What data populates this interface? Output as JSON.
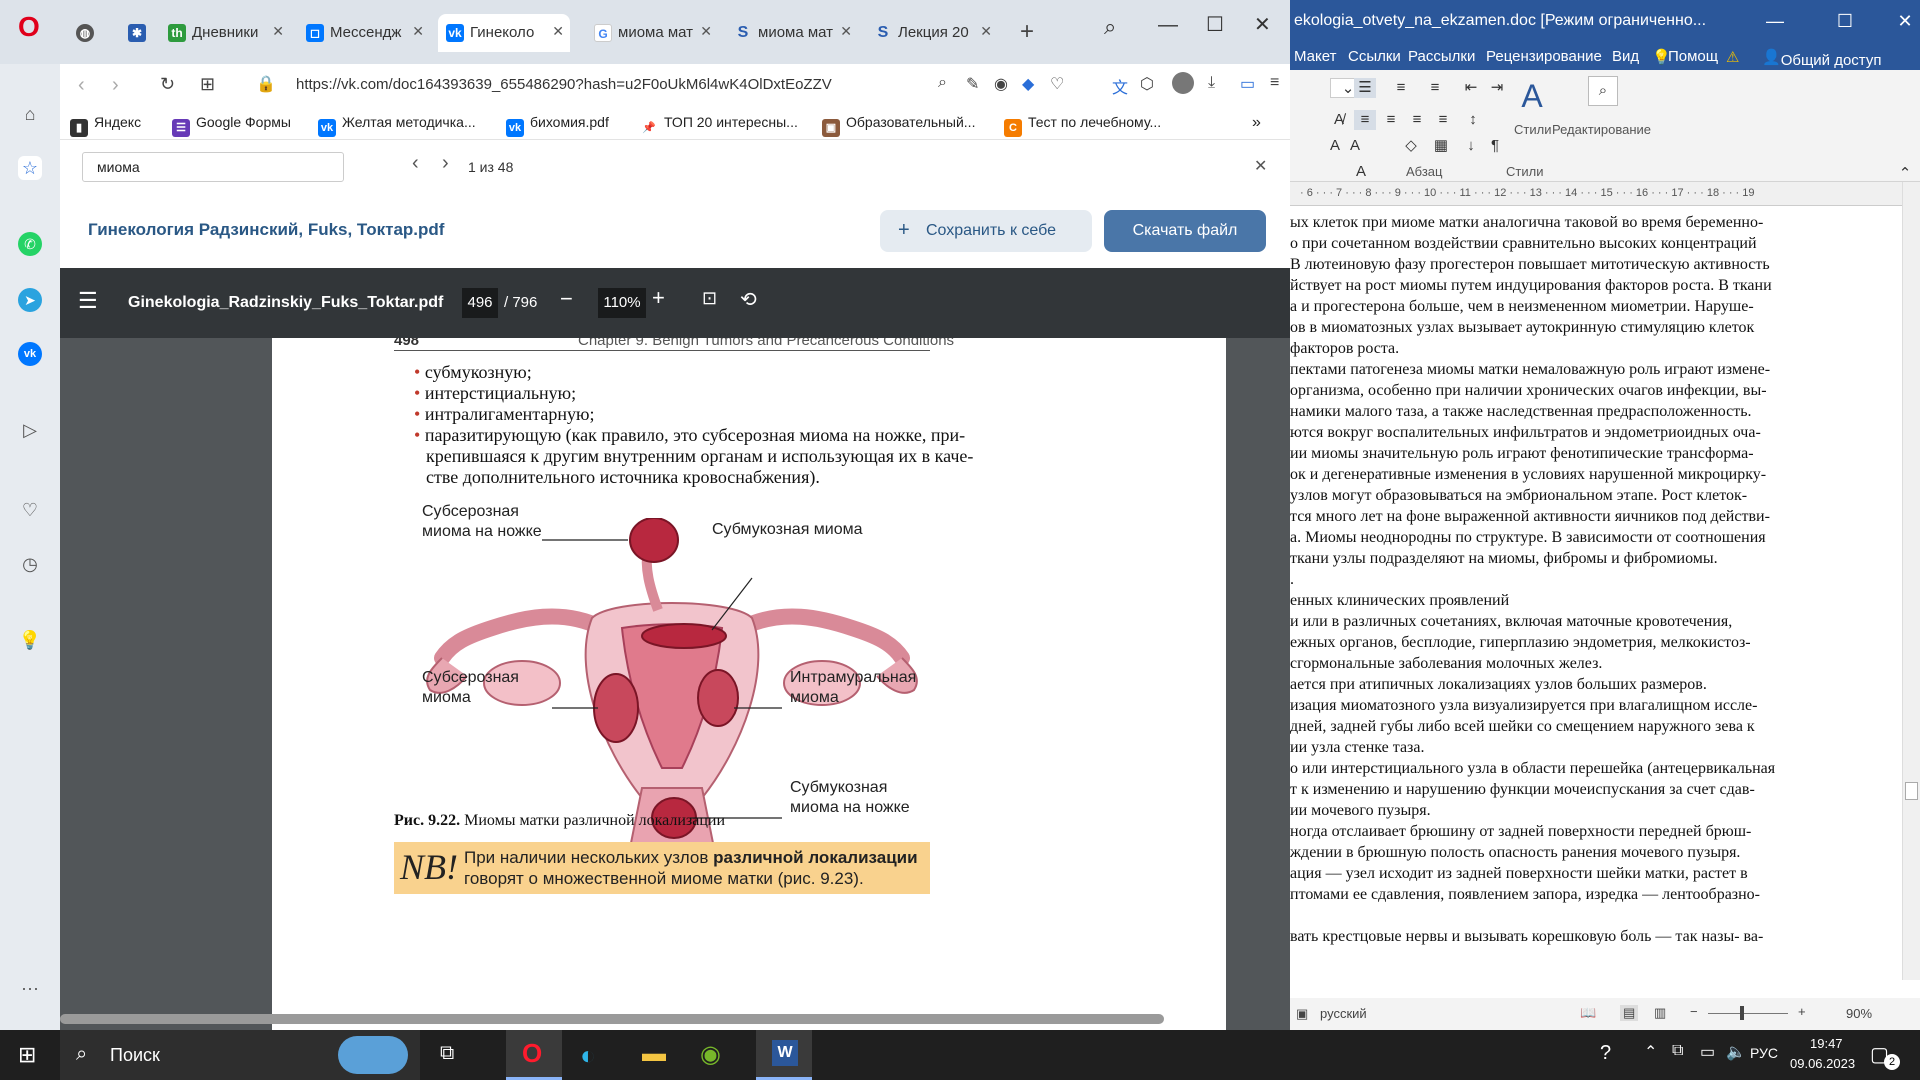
{
  "browser": {
    "tabs": [
      {
        "label": "",
        "icon": "globe-icon"
      },
      {
        "label": "",
        "icon": "medical-icon"
      },
      {
        "label": "Дневники",
        "icon": "th-icon"
      },
      {
        "label": "Мессендж",
        "icon": "messenger-icon"
      },
      {
        "label": "Гинеколо",
        "icon": "vk-icon"
      },
      {
        "label": "миома мат",
        "icon": "google-icon"
      },
      {
        "label": "миома мат",
        "icon": "s-icon"
      },
      {
        "label": "Лекция 20",
        "icon": "s-icon"
      }
    ],
    "url": "https://vk.com/doc164393639_655486290?hash=u2F0oUkM6l4wK4OlDxtEoZZV",
    "bookmarks": [
      "Яндекс",
      "Google Формы",
      "Желтая методичка...",
      "бихомия.pdf",
      "ТОП 20 интересны...",
      "Образовательный...",
      "Тест по лечебному..."
    ],
    "find": {
      "query": "миома",
      "count": "1 из 48"
    }
  },
  "vk": {
    "doc_title": "Гинекология Радзинский, Fuks, Токтар.pdf",
    "save_label": "Сохранить к себе",
    "download_label": "Скачать файл"
  },
  "pdf": {
    "filename": "Ginekologia_Radzinskiy_Fuks_Toktar.pdf",
    "page_current": "496",
    "page_total": "/ 796",
    "zoom": "110%",
    "header_num": "498",
    "header_chapter": "Chapter 9. Benign Tumors and Precancerous Conditions",
    "bullets": [
      "субмукозную;",
      "интерстициальную;",
      "интралигаментарную;",
      "паразитирующую (как правило, это субсерозная миома на ножке, при-",
      "крепившаяся к другим внутренним органам и использующая их в каче-",
      "стве дополнительного источника кровоснабжения)."
    ],
    "labels": {
      "subserous_pedicle_1": "Субсерозная",
      "subserous_pedicle_2": "миома на ножке",
      "submucous": "Субмукозная миома",
      "subserous_1": "Субсерозная",
      "subserous_2": "миома",
      "intramural_1": "Интрамуральная",
      "intramural_2": "миома",
      "submucous_pedicle_1": "Субмукозная",
      "submucous_pedicle_2": "миома на ножке"
    },
    "caption_bold": "Рис. 9.22.",
    "caption_text": "Миомы матки различной локализации",
    "nb_mark": "NB!",
    "nb_line1_a": "При наличии нескольких узлов ",
    "nb_line1_b": "различной локализации",
    "nb_line2": "говорят о множественной миоме матки (рис. 9.23)."
  },
  "word": {
    "title": "ekologia_otvety_na_ekzamen.doc [Режим ограниченно...",
    "tabs": [
      "Макет",
      "Ссылки",
      "Рассылки",
      "Рецензирование",
      "Вид",
      "Помощ",
      "Общий доступ"
    ],
    "ribbon": {
      "styles": "Стили",
      "editing": "Редактирование",
      "paragraph": "Абзац",
      "styles_group": "Стили"
    },
    "ruler": "· 6 · · · 7 · · · 8 · · · 9 · · · 10 · · · 11 · · · 12 · · · 13 · · · 14 · · · 15 · · · 16 · · · 17 · · · 18 · · · 19",
    "lines": [
      "ых клеток при миоме матки аналогична таковой во время беременно-",
      "о при сочетанном воздействии сравнительно высоких концентраций",
      "В лютеиновую фазу прогестерон повышает митотическую активность",
      "йствует на рост миомы путем индуцирования факторов роста. В ткани",
      "а и прогестерона больше, чем в неизмененном миометрии. Наруше-",
      "ов в миоматозных узлах вызывает аутокринную стимуляцию клеток",
      "факторов роста.",
      "пектами патогенеза миомы матки немаловажную роль играют измене-",
      "организма, особенно при наличии хронических очагов инфекции, вы-",
      "намики малого таза, а также наследственная предрасположенность.",
      "ются вокруг воспалительных инфильтратов и эндометриоидных оча-",
      "ии миомы значительную роль играют фенотипические трансформа-",
      "ок и дегенеративные изменения в условиях нарушенной микроцирку-",
      "узлов могут образовываться на эмбриональном этапе. Рост клеток-",
      "тся много лет на фоне выраженной активности яичников под действи-",
      "а. Миомы неоднородны по структуре. В зависимости от соотношения",
      "ткани узлы подразделяют на миомы, фибромы и фибромиомы.",
      ".",
      "енных клинических проявлений",
      "и или в различных сочетаниях, включая маточные кровотечения,",
      "ежных органов, бесплодие, гиперплазию эндометрия, мелкокистоз-",
      "сгормональные заболевания молочных желез.",
      "ается при атипичных локализациях узлов больших размеров.",
      "изация миоматозного узла визуализируется при влагалищном иссле-",
      "дней, задней губы либо всей шейки со смещением наружного зева к",
      "ии узла стенке таза.",
      "о или интерстициального узла в области перешейка (антецервикальная",
      "т к изменению и нарушению функции мочеиспускания за счет сдав-",
      "ии мочевого пузыря.",
      "ногда отслаивает брюшину от задней поверхности передней брюш-",
      "ждении в брюшную полость опасность ранения мочевого пузыря.",
      "ация — узел исходит из задней поверхности шейки матки, растет в",
      "птомами ее сдавления, появлением запора, изредка — лентообразно-",
      "",
      "вать крестцовые нервы и вызывать корешковую боль — так назы- ва-"
    ],
    "status_lang": "русский",
    "zoom": "90%"
  },
  "taskbar": {
    "search": "Поиск",
    "lang": "РУС",
    "time": "19:47",
    "date": "09.06.2023",
    "notif": "2"
  }
}
